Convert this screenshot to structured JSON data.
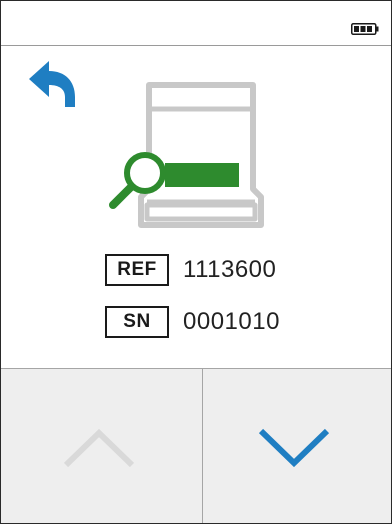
{
  "status_bar": {
    "battery_icon": "battery-icon",
    "battery_level": 0.75
  },
  "header": {
    "back_icon": "back-arrow-icon",
    "accent_color": "#1f7ec2"
  },
  "illustration": {
    "icon": "device-search-icon",
    "highlight_color": "#2e8b2e",
    "outline_color": "#c8c8c8"
  },
  "identifiers": {
    "ref_label": "REF",
    "ref_value": "1113600",
    "sn_label": "SN",
    "sn_value": "0001010"
  },
  "navigation": {
    "up_icon": "chevron-up-icon",
    "up_enabled": false,
    "down_icon": "chevron-down-icon",
    "down_enabled": true,
    "disabled_color": "#d9d9d9",
    "active_color": "#1f7ec2"
  }
}
